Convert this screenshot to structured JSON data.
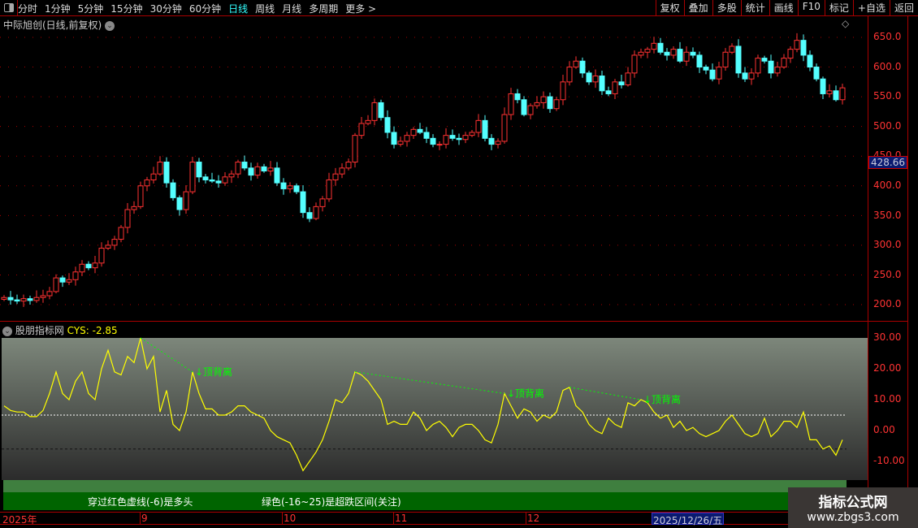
{
  "toolbar": {
    "periods": [
      "分时",
      "1分钟",
      "5分钟",
      "15分钟",
      "30分钟",
      "60分钟",
      "日线",
      "周线",
      "月线",
      "多周期",
      "更多 >"
    ],
    "active_period": "日线",
    "tools": [
      "复权",
      "叠加",
      "多股",
      "统计",
      "画线",
      "F10",
      "标记",
      "+自选",
      "返回"
    ]
  },
  "stock": {
    "title": "中际旭创(日线,前复权)"
  },
  "price_axis": {
    "ticks": [
      "650.0",
      "600.0",
      "550.0",
      "500.0",
      "450.0",
      "400.0",
      "350.0",
      "300.0",
      "250.0",
      "200.0"
    ],
    "current": "428.66"
  },
  "indicator": {
    "name": "股朋指标网",
    "value_label": "CYS: -2.85",
    "ticks": [
      "30.00",
      "20.00",
      "10.00",
      "0.00",
      "-10.00"
    ],
    "upper_line": 5,
    "lower_line": -6,
    "divergence_label": "顶背离",
    "legend1": "穿过红色虚线(-6)是多头",
    "legend2": "绿色(-16~25)是超跌区间(关注)"
  },
  "date_axis": {
    "labels": [
      "2025年",
      "9",
      "10",
      "11",
      "12"
    ],
    "cursor_date": "2025/12/26/五"
  },
  "watermark": {
    "line1": "指标公式网",
    "line2": "www.zbgs3.com"
  },
  "colors": {
    "up": "#ff3232",
    "down": "#54ffff",
    "cys": "#ffff00",
    "divergence": "#00ff00",
    "axis": "#ff3333"
  },
  "chart_data": [
    {
      "type": "candlestick",
      "ylim": [
        180,
        670
      ],
      "close": [
        212,
        208,
        206,
        210,
        207,
        212,
        215,
        222,
        245,
        238,
        242,
        255,
        268,
        262,
        270,
        295,
        300,
        310,
        330,
        360,
        365,
        400,
        410,
        420,
        440,
        405,
        380,
        360,
        390,
        440,
        415,
        410,
        408,
        405,
        415,
        420,
        440,
        430,
        418,
        432,
        425,
        430,
        405,
        395,
        400,
        390,
        355,
        345,
        365,
        378,
        410,
        420,
        430,
        440,
        485,
        505,
        510,
        540,
        515,
        490,
        470,
        475,
        485,
        495,
        490,
        480,
        470,
        470,
        485,
        480,
        478,
        485,
        490,
        510,
        480,
        470,
        475,
        520,
        555,
        545,
        520,
        535,
        540,
        550,
        530,
        545,
        575,
        600,
        610,
        590,
        575,
        585,
        560,
        555,
        575,
        570,
        590,
        620,
        625,
        630,
        640,
        625,
        620,
        630,
        610,
        625,
        620,
        600,
        595,
        580,
        600,
        625,
        635,
        590,
        580,
        590,
        615,
        610,
        590,
        600,
        615,
        630,
        645,
        620,
        600,
        580,
        555,
        560,
        545,
        565
      ]
    },
    {
      "type": "line",
      "name": "CYS",
      "ylim": [
        -15,
        32
      ],
      "values": [
        8,
        6.5,
        6,
        6,
        4.5,
        4.5,
        6.5,
        12,
        19,
        12,
        10,
        16,
        19,
        12,
        10,
        20,
        26,
        19,
        18,
        24,
        22,
        30,
        20,
        24,
        6,
        13,
        2,
        0,
        6,
        19,
        12,
        7,
        7,
        5,
        5,
        6,
        8,
        8,
        6,
        5,
        4,
        0,
        -2,
        -3,
        -4,
        -8,
        -13,
        -10,
        -7,
        -3,
        3,
        10,
        9,
        12,
        19,
        18,
        16,
        13,
        10,
        2,
        3,
        2,
        2,
        6,
        4,
        0,
        2,
        3,
        1,
        -2,
        1,
        2,
        2,
        0,
        -3,
        -4,
        2,
        12,
        8,
        4,
        7,
        6,
        3,
        5,
        4,
        6,
        13,
        14,
        8,
        6,
        2,
        0,
        -1,
        4,
        2,
        1,
        9,
        8,
        10,
        9,
        6,
        4,
        5,
        1,
        3,
        0,
        1,
        -1,
        -2,
        -1,
        0,
        3,
        5,
        2,
        -1,
        -2,
        -1,
        4,
        -2,
        0,
        3,
        3,
        1,
        6,
        -3,
        -3,
        -6,
        -5,
        -8,
        -3
      ],
      "divergences": [
        [
          21,
          29
        ],
        [
          54,
          77
        ],
        [
          87,
          98
        ]
      ]
    }
  ]
}
